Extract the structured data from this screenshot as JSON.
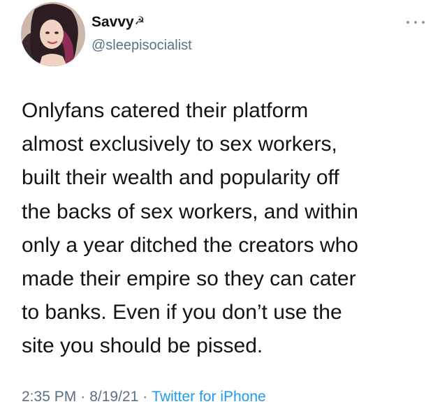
{
  "tweet": {
    "display_name": "Savvy",
    "name_emoji": "☭",
    "handle": "@sleepisocialist",
    "text": "Onlyfans catered their platform\nalmost exclusively to sex workers,\nbuilt their wealth and popularity off\nthe backs of sex workers, and within\nonly a year ditched the creators who\nmade their empire so they can cater\nto banks. Even if you don’t use the\nsite you should be pissed.",
    "time": "2:35 PM",
    "separator": "·",
    "date": "8/19/21",
    "source": "Twitter for iPhone",
    "more_icon": "more-horizontal-icon"
  },
  "colors": {
    "text": "#0f1419",
    "secondary": "#5b7083",
    "link": "#1d9bf0"
  }
}
